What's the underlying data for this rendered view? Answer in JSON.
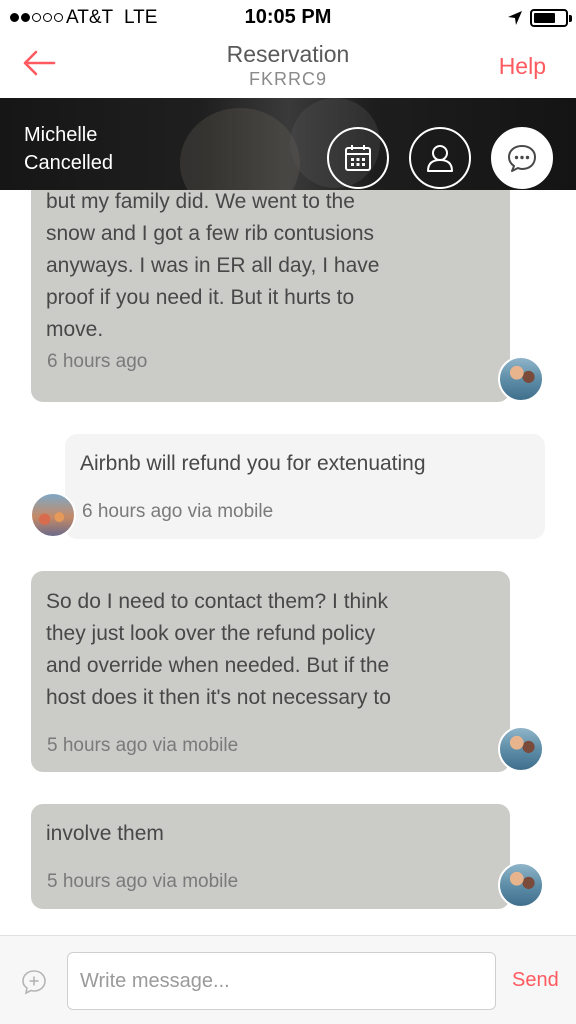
{
  "status_bar": {
    "carrier": "AT&T",
    "network": "LTE",
    "time": "10:05 PM"
  },
  "nav": {
    "back_icon": "back-arrow-icon",
    "title": "Reservation",
    "code": "FKRRC9",
    "help_label": "Help"
  },
  "header": {
    "guest_name": "Michelle",
    "guest_status": "Cancelled",
    "buttons": [
      "calendar-icon",
      "profile-icon",
      "messages-icon"
    ]
  },
  "messages": [
    {
      "direction": "incoming",
      "text": "but my family did. We went to the\nsnow and I got a few rib contusions\nanyways. I was in ER all day, I have\nproof if you need it. But it hurts to\nmove.",
      "meta": "6 hours ago"
    },
    {
      "direction": "outgoing",
      "text": "Airbnb will refund you for extenuating",
      "meta": "6 hours ago via mobile"
    },
    {
      "direction": "incoming",
      "text": "So do I need to contact them? I think\nthey just look over the refund policy\nand override when needed. But if the\nhost does it then it's not necessary to",
      "meta": "5 hours ago via mobile"
    },
    {
      "direction": "incoming",
      "text": "involve them",
      "meta": "5 hours ago via mobile"
    }
  ],
  "composer": {
    "placeholder": "Write message...",
    "value": "",
    "send_label": "Send"
  },
  "colors": {
    "accent": "#ff5a5f",
    "incoming_bubble": "#cbcbc8",
    "outgoing_bubble": "#f4f4f4"
  }
}
